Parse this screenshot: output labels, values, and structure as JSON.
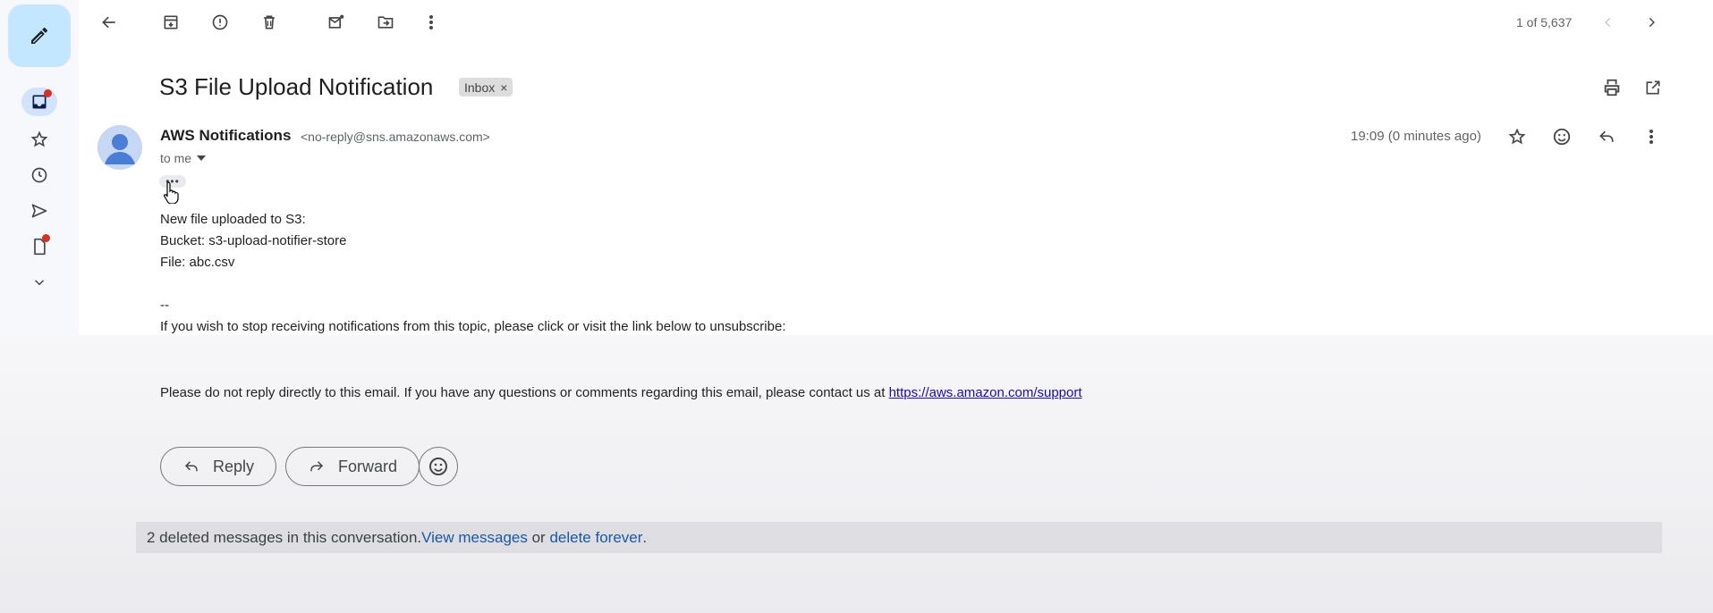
{
  "toolbar": {
    "back_icon": "arrow-left-icon",
    "archive_icon": "archive-icon",
    "spam_icon": "report-spam-icon",
    "delete_icon": "trash-icon",
    "mark_unread_icon": "mark-unread-icon",
    "move_icon": "move-to-folder-icon",
    "more_icon": "more-vert-icon",
    "pagination": "1 of 5,637"
  },
  "email": {
    "subject": "S3 File Upload Notification",
    "label": "Inbox",
    "label_close": "×",
    "sender_name": "AWS Notifications",
    "sender_email": "<no-reply@sns.amazonaws.com>",
    "to": "to me",
    "time": "19:09 (0 minutes ago)",
    "ellipsis": "•••",
    "body": {
      "line1": "New file uploaded to S3:",
      "line2": "Bucket: s3-upload-notifier-store",
      "line3": "File: abc.csv",
      "separator": "--",
      "unsubscribe_text": "If you wish to stop receiving notifications from this topic, please click or visit the link below to unsubscribe:",
      "support_text": "Please do not reply directly to this email. If you have any questions or comments regarding this email, please contact us at ",
      "support_link": "https://aws.amazon.com/support"
    }
  },
  "actions": {
    "reply_label": "Reply",
    "forward_label": "Forward"
  },
  "deleted_bar": {
    "text": "2 deleted messages in this conversation. ",
    "view_link": "View messages",
    "or_text": " or ",
    "delete_link": "delete forever",
    "end": "."
  },
  "colors": {
    "compose_bg": "#c2e7ff",
    "notification_dot": "#d93025",
    "link": "#1a58a6"
  }
}
